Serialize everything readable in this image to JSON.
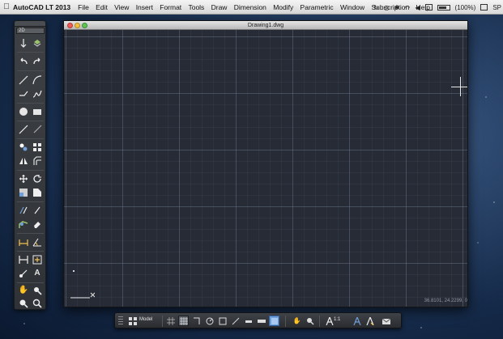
{
  "menubar": {
    "app_name": "AutoCAD LT 2013",
    "items": [
      "File",
      "Edit",
      "View",
      "Insert",
      "Format",
      "Tools",
      "Draw",
      "Dimension",
      "Modify",
      "Parametric",
      "Window",
      "Subscription",
      "Help"
    ],
    "battery_text": "(100%)",
    "clock_text": "SP"
  },
  "window": {
    "title": "Drawing1.dwg"
  },
  "canvas": {
    "coordinates": "36.8101, 24.2299, 0"
  },
  "palette": {
    "selector_value": "2D"
  },
  "statusbar": {
    "model_label": "Model",
    "scale_label": "1:1"
  },
  "colors": {
    "canvas_bg": "#262b35",
    "grid_major": "#6b7790",
    "accent_blue": "#6f9ed8"
  }
}
